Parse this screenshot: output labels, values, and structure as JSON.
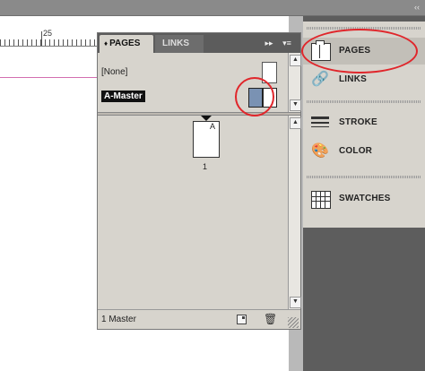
{
  "window": {
    "collapse_icon": "collapse-all-icon",
    "collapse_glyph": "‹‹"
  },
  "ruler": {
    "label": "25"
  },
  "pages_panel": {
    "tabs": [
      {
        "label": "PAGES",
        "active": true,
        "arrow_glyph": "♦"
      },
      {
        "label": "LINKS",
        "active": false
      }
    ],
    "expand_glyph": "▸▸",
    "menu_glyph": "▾≡",
    "masters": [
      {
        "label": "[None]",
        "selected": false
      },
      {
        "label": "A-Master",
        "selected": true
      }
    ],
    "pages": [
      {
        "number": "1",
        "master_prefix": "A"
      }
    ],
    "footer_status": "1 Master",
    "new_page_icon": "new-page-icon",
    "delete_icon": "trash-icon",
    "delete_glyph": "🗑",
    "scroll_up_glyph": "▲",
    "scroll_down_glyph": "▼"
  },
  "dock": {
    "items": [
      {
        "label": "PAGES",
        "icon": "pages-icon",
        "active": true
      },
      {
        "label": "LINKS",
        "icon": "links-icon",
        "glyph": "🔗",
        "active": false
      },
      {
        "label": "STROKE",
        "icon": "stroke-icon",
        "active": false
      },
      {
        "label": "COLOR",
        "icon": "color-icon",
        "glyph": "🎨",
        "active": false
      },
      {
        "label": "SWATCHES",
        "icon": "swatches-icon",
        "active": false
      }
    ]
  },
  "colors": {
    "annotation_red": "#e0262b",
    "master_thumb_blue": "#7a92b3",
    "guide_pink": "#d36fb0",
    "panel_bg": "#d7d4cd",
    "dock_bg": "#5d5d5d"
  }
}
